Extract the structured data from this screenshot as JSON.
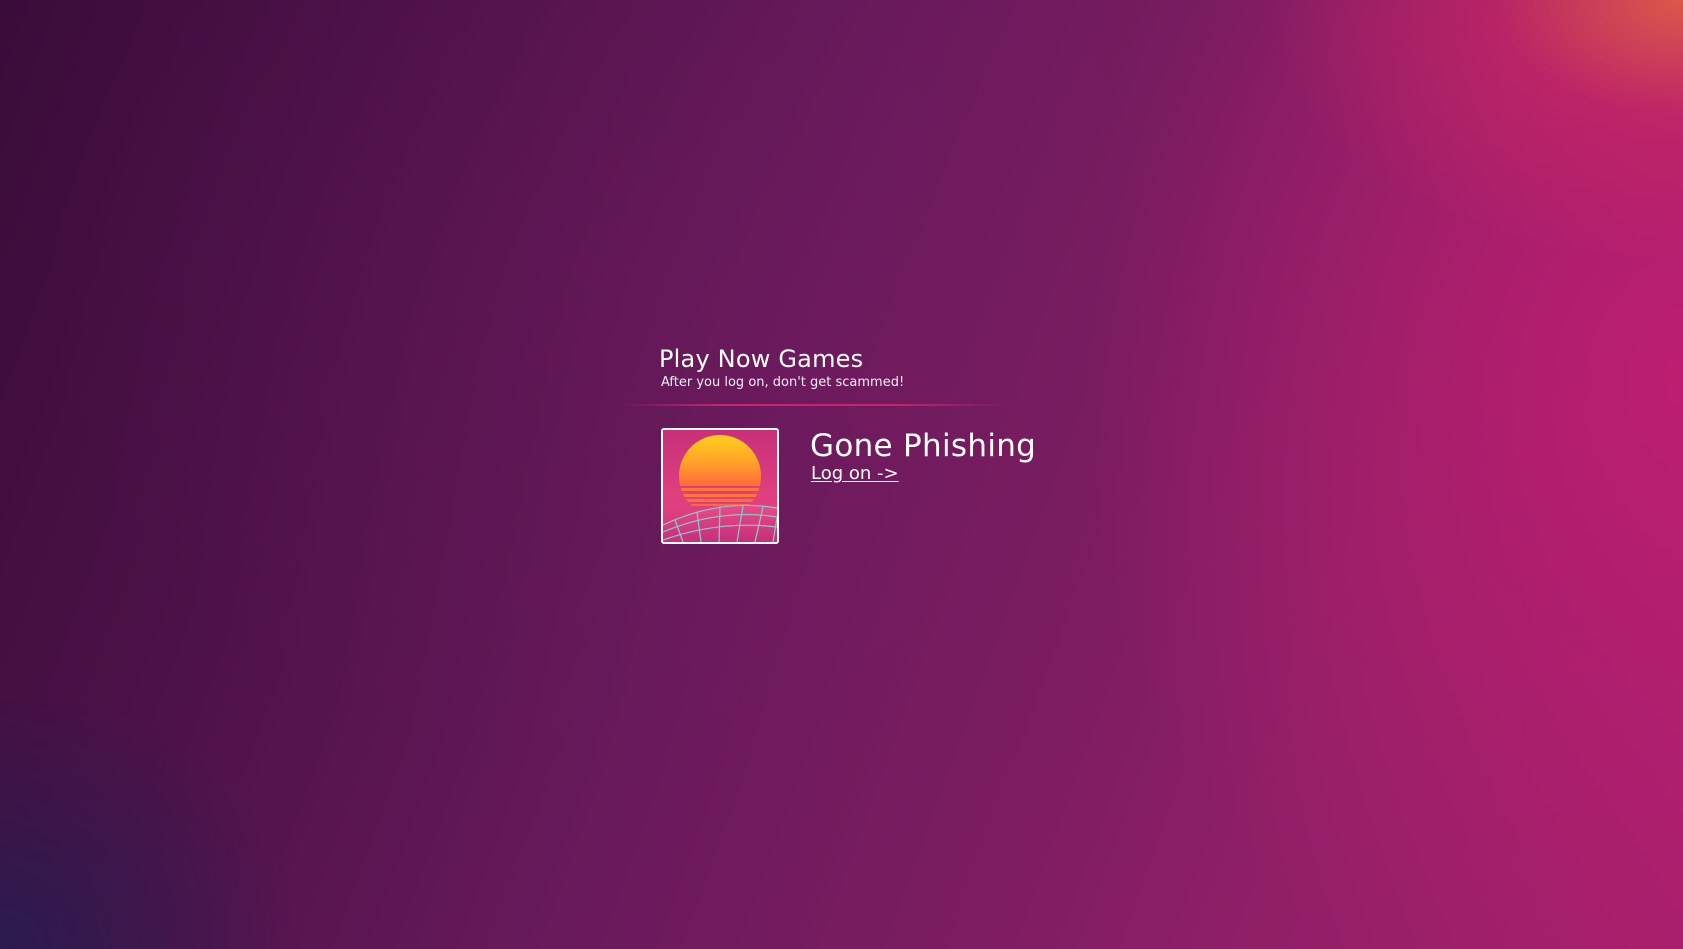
{
  "header": {
    "title": "Play Now Games",
    "subtitle": "After you log on, don't get scammed!"
  },
  "games": [
    {
      "name": "Gone Phishing",
      "link_label": "Log on ->",
      "thumbnail_icon": "synthwave-sunset-icon"
    }
  ],
  "colors": {
    "background_dark": "#3a0c3a",
    "background_mid": "#7a1c60",
    "background_bright": "#a51f6c",
    "corner_accent": "#de5c48",
    "divider": "#d7286e",
    "text": "#ffffff"
  }
}
